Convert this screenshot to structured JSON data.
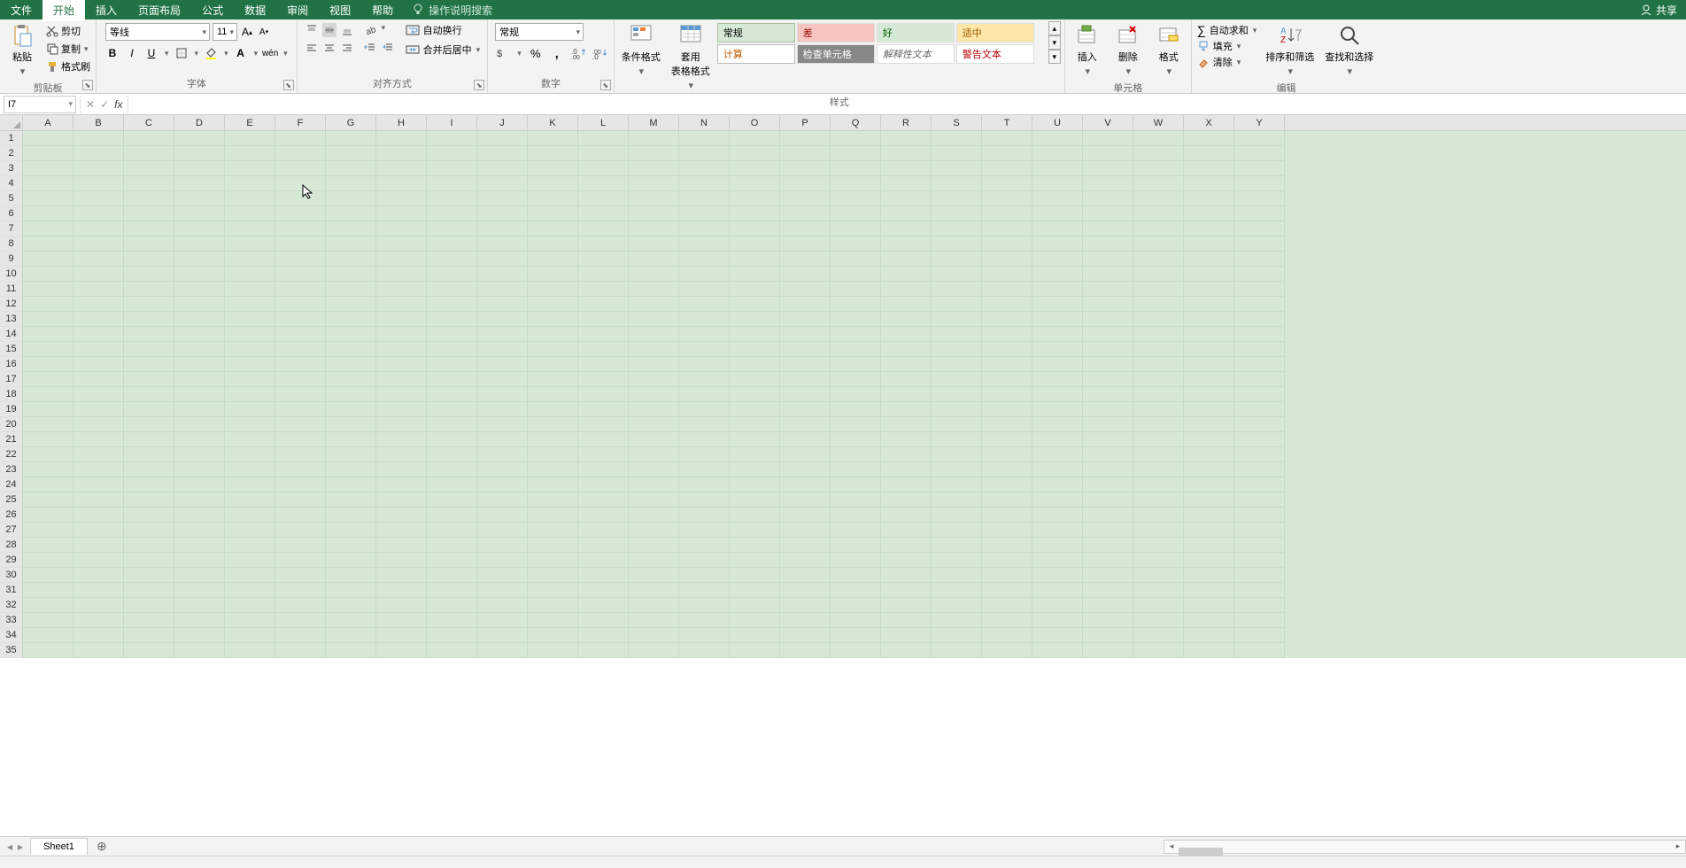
{
  "tabs": {
    "file": "文件",
    "home": "开始",
    "insert": "插入",
    "page": "页面布局",
    "formula": "公式",
    "data": "数据",
    "review": "审阅",
    "view": "视图",
    "help": "帮助"
  },
  "tellme": "操作说明搜索",
  "share": "共享",
  "clipboard": {
    "paste": "粘贴",
    "cut": "剪切",
    "copy": "复制",
    "fmtpainter": "格式刷",
    "label": "剪贴板"
  },
  "font": {
    "name": "等线",
    "size": "11",
    "label": "字体"
  },
  "align": {
    "wrap": "自动换行",
    "merge": "合并后居中",
    "label": "对齐方式"
  },
  "number": {
    "general": "常规",
    "label": "数字"
  },
  "styles": {
    "cond": "条件格式",
    "table": "套用\n表格格式",
    "normal": "常规",
    "bad": "差",
    "good": "好",
    "neutral": "适中",
    "calc": "计算",
    "check": "检查单元格",
    "explan": "解释性文本",
    "warn": "警告文本",
    "label": "样式"
  },
  "cells": {
    "insert": "插入",
    "delete": "删除",
    "format": "格式",
    "label": "单元格"
  },
  "editing": {
    "autosum": "自动求和",
    "fill": "填充",
    "clear": "清除",
    "sort": "排序和筛选",
    "find": "查找和选择",
    "label": "编辑"
  },
  "namebox": "I7",
  "columns": [
    "A",
    "B",
    "C",
    "D",
    "E",
    "F",
    "G",
    "H",
    "I",
    "J",
    "K",
    "L",
    "M",
    "N",
    "O",
    "P",
    "Q",
    "R",
    "S",
    "T",
    "U",
    "V",
    "W",
    "X",
    "Y"
  ],
  "rows": [
    "1",
    "2",
    "3",
    "4",
    "5",
    "6",
    "7",
    "8",
    "9",
    "10",
    "11",
    "12",
    "13",
    "14",
    "15",
    "16",
    "17",
    "18",
    "19",
    "20",
    "21",
    "22",
    "23",
    "24",
    "25",
    "26",
    "27",
    "28",
    "29",
    "30",
    "31",
    "32",
    "33",
    "34",
    "35"
  ],
  "sheet": "Sheet1"
}
